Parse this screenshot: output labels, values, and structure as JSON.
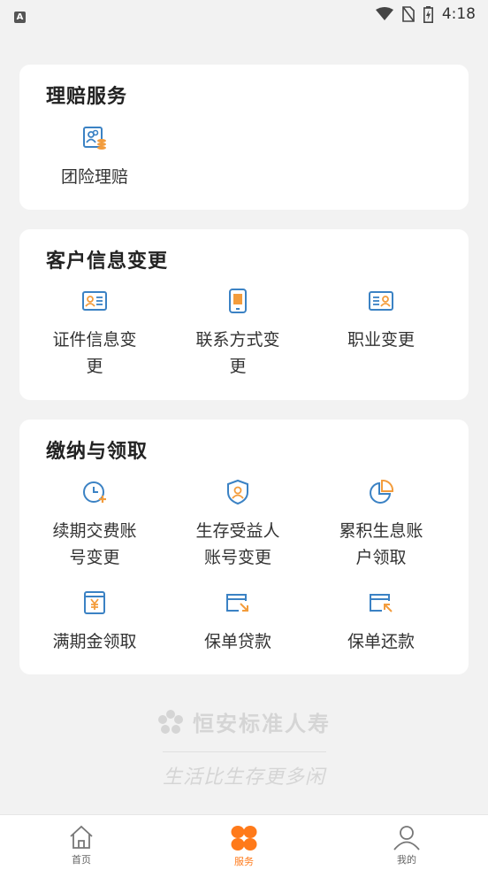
{
  "status_bar": {
    "time": "4:18",
    "left_badge": "A"
  },
  "sections": [
    {
      "title": "理赔服务",
      "items": [
        {
          "label": "团险理赔",
          "icon": "group-claim-icon"
        }
      ]
    },
    {
      "title": "客户信息变更",
      "items": [
        {
          "label": "证件信息变更",
          "icon": "id-card-icon"
        },
        {
          "label": "联系方式变更",
          "icon": "phone-icon"
        },
        {
          "label": "职业变更",
          "icon": "job-card-icon"
        }
      ]
    },
    {
      "title": "缴纳与领取",
      "items": [
        {
          "label": "续期交费账号变更",
          "icon": "clock-plus-icon"
        },
        {
          "label": "生存受益人账号变更",
          "icon": "shield-user-icon"
        },
        {
          "label": "累积生息账户领取",
          "icon": "pie-chart-icon"
        },
        {
          "label": "满期金领取",
          "icon": "yen-box-icon"
        },
        {
          "label": "保单贷款",
          "icon": "card-arrow-in-icon"
        },
        {
          "label": "保单还款",
          "icon": "card-arrow-out-icon"
        }
      ]
    }
  ],
  "watermark": {
    "brand": "恒安标准人寿",
    "slogan": "生活比生存更多闲"
  },
  "tabbar": [
    {
      "label": "首页",
      "icon": "home-icon"
    },
    {
      "label": "服务",
      "icon": "service-grid-icon"
    },
    {
      "label": "我的",
      "icon": "user-icon"
    }
  ],
  "colors": {
    "accent": "#ff7a1a",
    "icon_blue": "#3b82c4",
    "icon_orange": "#f39c3c"
  }
}
